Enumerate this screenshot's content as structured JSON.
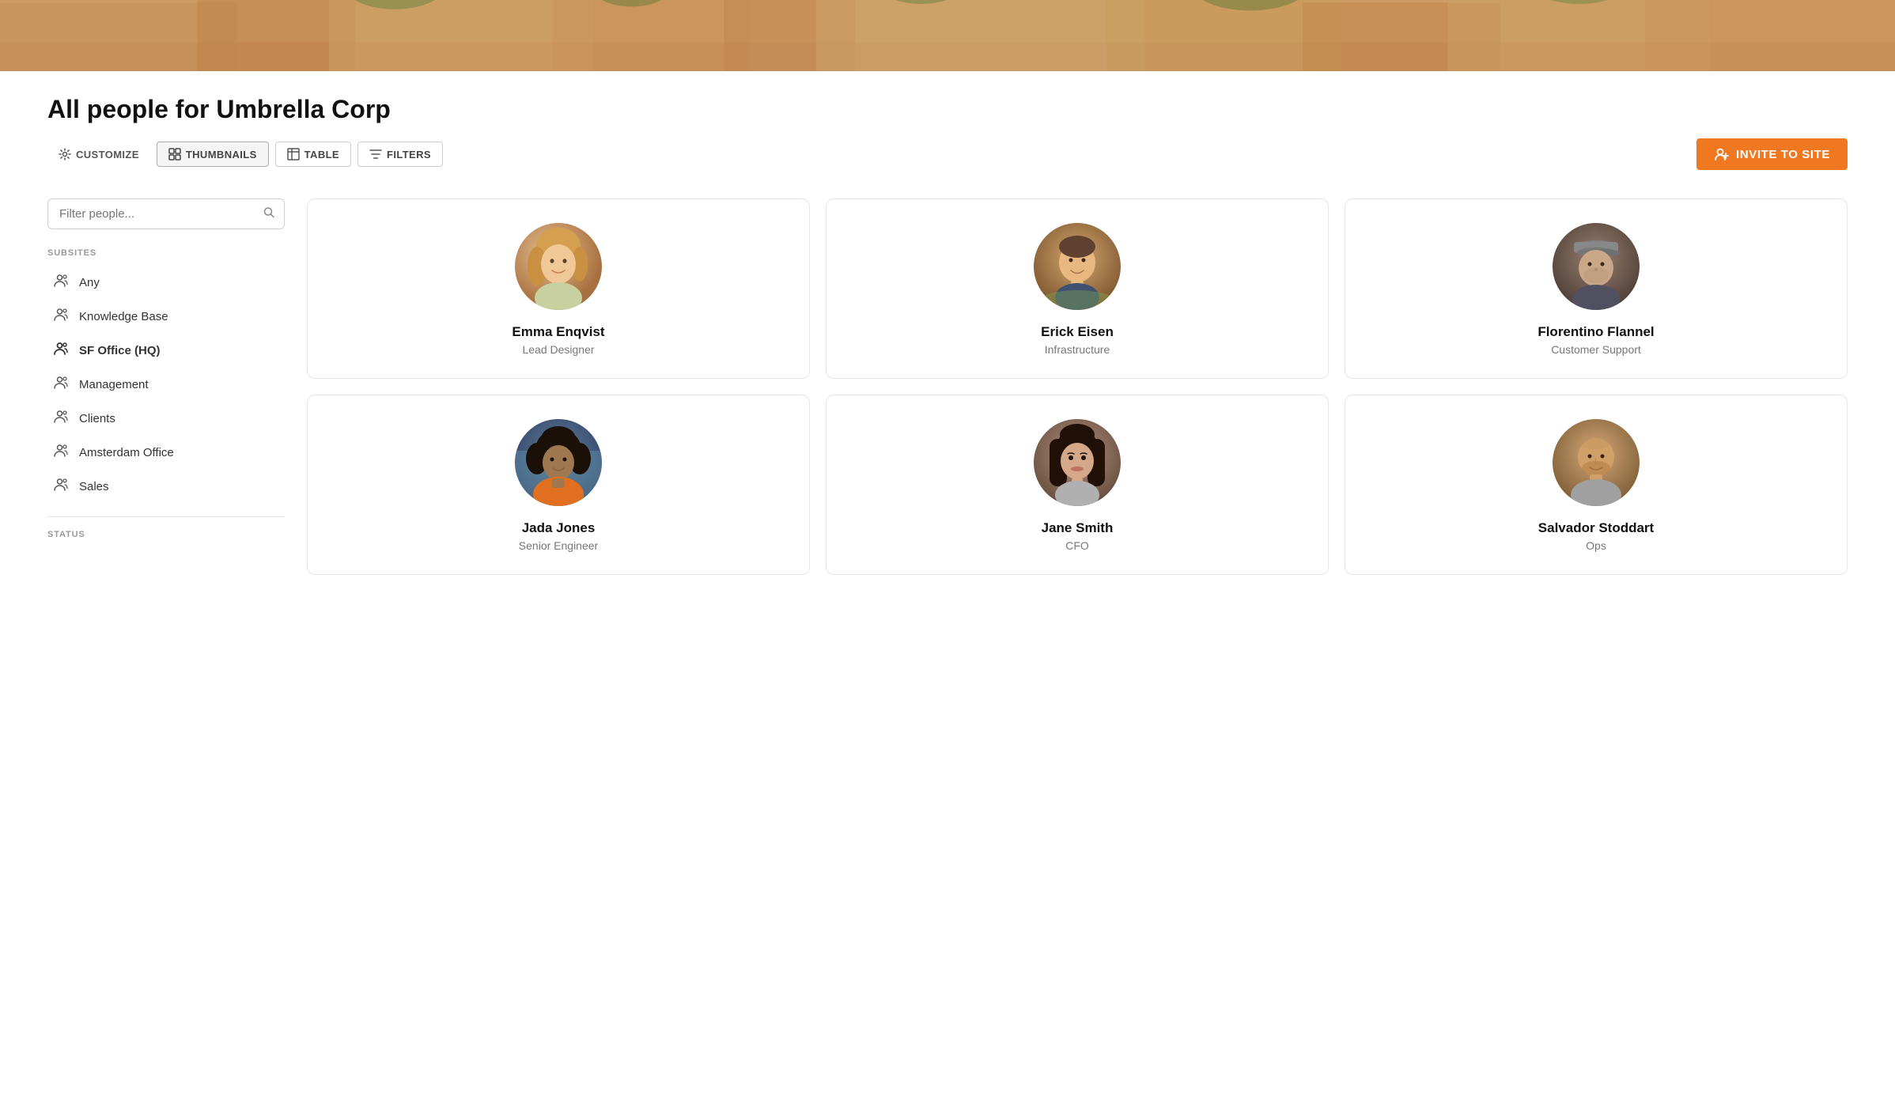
{
  "hero": {
    "alt": "Office background photo"
  },
  "page": {
    "title": "All people for Umbrella Corp"
  },
  "toolbar": {
    "customize_label": "CUSTOMIZE",
    "thumbnails_label": "THUMBNAILS",
    "table_label": "TABLE",
    "filters_label": "FILTERS",
    "invite_label": "INVITE TO SITE"
  },
  "sidebar": {
    "filter_placeholder": "Filter people...",
    "subsites_label": "SUBSITES",
    "status_label": "STATUS",
    "items": [
      {
        "id": "any",
        "label": "Any",
        "active": false
      },
      {
        "id": "knowledge-base",
        "label": "Knowledge Base",
        "active": false
      },
      {
        "id": "sf-office",
        "label": "SF Office (HQ)",
        "active": true
      },
      {
        "id": "management",
        "label": "Management",
        "active": false
      },
      {
        "id": "clients",
        "label": "Clients",
        "active": false
      },
      {
        "id": "amsterdam-office",
        "label": "Amsterdam Office",
        "active": false
      },
      {
        "id": "sales",
        "label": "Sales",
        "active": false
      }
    ]
  },
  "people": [
    {
      "id": "emma",
      "name": "Emma Enqvist",
      "role": "Lead Designer",
      "avatar_color": "#c8a47a"
    },
    {
      "id": "erick",
      "name": "Erick Eisen",
      "role": "Infrastructure",
      "avatar_color": "#a07840"
    },
    {
      "id": "florentino",
      "name": "Florentino Flannel",
      "role": "Customer Support",
      "avatar_color": "#706050"
    },
    {
      "id": "jada",
      "name": "Jada Jones",
      "role": "Senior Engineer",
      "avatar_color": "#406080"
    },
    {
      "id": "jane",
      "name": "Jane Smith",
      "role": "CFO",
      "avatar_color": "#8a6858"
    },
    {
      "id": "salvador",
      "name": "Salvador Stoddart",
      "role": "Ops",
      "avatar_color": "#b08858"
    }
  ],
  "colors": {
    "accent": "#f07820",
    "border": "#e5e5e5",
    "active_text": "#111"
  }
}
